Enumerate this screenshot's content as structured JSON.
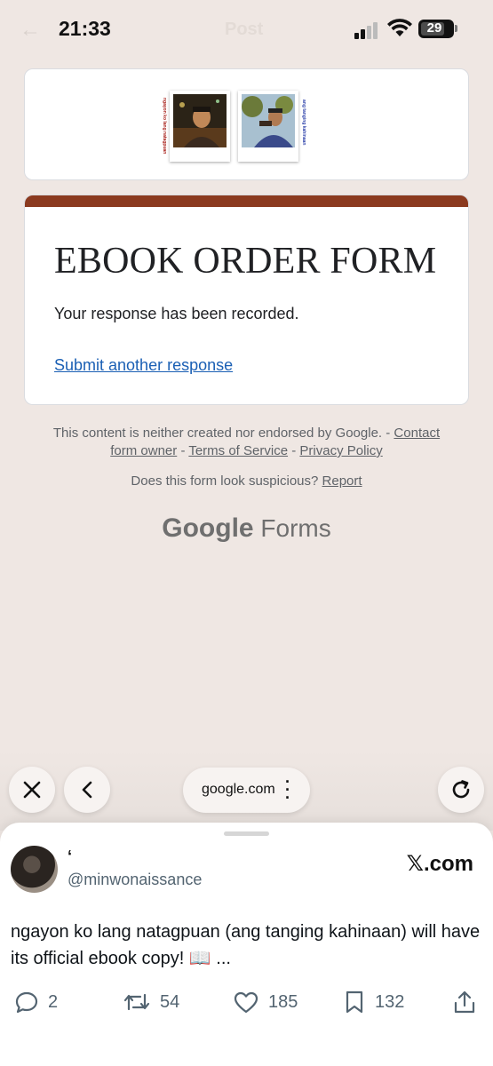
{
  "status_bar": {
    "time": "21:33",
    "battery": "29",
    "background_title": "Post"
  },
  "header_image": {
    "left_caption": "ngayon ko lang natagpuan",
    "right_caption": "ang tanging kahinaan"
  },
  "form": {
    "title": "EBOOK ORDER FORM",
    "message": "Your response has been recorded.",
    "submit_another": "Submit another response",
    "accent_color": "#8b3a1f"
  },
  "footer": {
    "disclaimer": "This content is neither created nor endorsed by Google. -",
    "contact_line1": "Contact",
    "contact_line2": "form owner",
    "sep1": "-",
    "terms": "Terms of Service",
    "sep2": "-",
    "privacy": "Privacy Policy",
    "suspicious": "Does this form look suspicious?",
    "report": "Report",
    "brand_google": "Google",
    "brand_forms": "Forms"
  },
  "browser": {
    "url": "google.com",
    "icons": [
      "close-icon",
      "back-chevron-icon",
      "more-vertical-icon",
      "reload-icon"
    ]
  },
  "tweet": {
    "display_name": "‘",
    "username": "@minwonaissance",
    "source": "𝕏.com",
    "text": "ngayon ko lang natagpuan (ang tanging kahinaan) will have its official ebook copy! 📖 ...",
    "replies": "2",
    "retweets": "54",
    "likes": "185",
    "bookmarks": "132"
  }
}
